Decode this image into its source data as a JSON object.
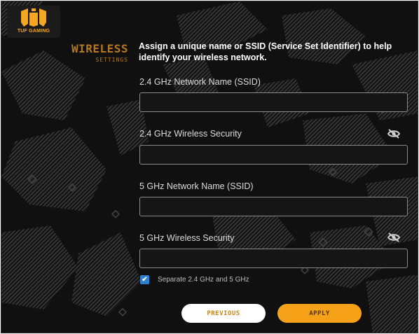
{
  "brand": {
    "logo_text": "TUF GAMING",
    "accent": "#f5a623"
  },
  "section": {
    "title": "WIRELESS",
    "subtitle": "SETTINGS"
  },
  "intro_text": "Assign a unique name or SSID (Service Set Identifier) to help identify your wireless network.",
  "fields": [
    {
      "label": "2.4 GHz Network Name (SSID)",
      "value": "",
      "placeholder": "",
      "has_visibility_toggle": false
    },
    {
      "label": "2.4 GHz Wireless Security",
      "value": "",
      "placeholder": "",
      "has_visibility_toggle": true,
      "toggle_icon": "eye-slash-icon"
    },
    {
      "label": "5 GHz Network Name (SSID)",
      "value": "",
      "placeholder": "",
      "has_visibility_toggle": false
    },
    {
      "label": "5 GHz Wireless Security",
      "value": "",
      "placeholder": "",
      "has_visibility_toggle": true,
      "toggle_icon": "eye-slash-icon"
    }
  ],
  "separate_bands": {
    "label": "Separate 2.4 GHz and 5 GHz",
    "checked": true
  },
  "buttons": {
    "previous": "PREVIOUS",
    "apply": "APPLY"
  },
  "colors": {
    "checkbox": "#2f7fd1",
    "apply_button": "#f6a218",
    "previous_button": "#ffffff"
  }
}
